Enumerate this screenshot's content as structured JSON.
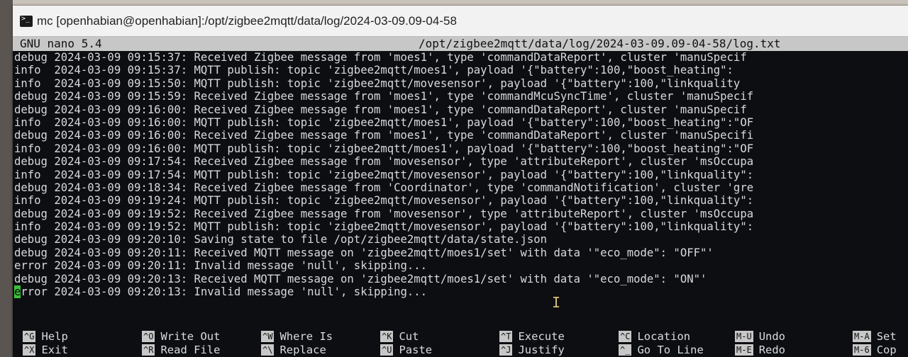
{
  "window": {
    "title": "mc [openhabian@openhabian]:/opt/zigbee2mqtt/data/log/2024-03-09.09-04-58"
  },
  "nano": {
    "version": "GNU nano 5.4",
    "filepath": "/opt/zigbee2mqtt/data/log/2024-03-09.09-04-58/log.txt"
  },
  "log_lines": [
    "debug 2024-03-09 09:15:37: Received Zigbee message from 'moes1', type 'commandDataReport', cluster 'manuSpecif",
    "info  2024-03-09 09:15:37: MQTT publish: topic 'zigbee2mqtt/moes1', payload '{\"battery\":100,\"boost_heating\":",
    "info  2024-03-09 09:15:50: MQTT publish: topic 'zigbee2mqtt/movesensor', payload '{\"battery\":100,\"linkquality",
    "debug 2024-03-09 09:15:59: Received Zigbee message from 'moes1', type 'commandMcuSyncTime', cluster 'manuSpecif",
    "debug 2024-03-09 09:16:00: Received Zigbee message from 'moes1', type 'commandDataReport', cluster 'manuSpecif",
    "info  2024-03-09 09:16:00: MQTT publish: topic 'zigbee2mqtt/moes1', payload '{\"battery\":100,\"boost_heating\":\"OF",
    "debug 2024-03-09 09:16:00: Received Zigbee message from 'moes1', type 'commandDataReport', cluster 'manuSpecifi",
    "info  2024-03-09 09:16:00: MQTT publish: topic 'zigbee2mqtt/moes1', payload '{\"battery\":100,\"boost_heating\":\"OF",
    "debug 2024-03-09 09:17:54: Received Zigbee message from 'movesensor', type 'attributeReport', cluster 'msOccupa",
    "info  2024-03-09 09:17:54: MQTT publish: topic 'zigbee2mqtt/movesensor', payload '{\"battery\":100,\"linkquality\":",
    "debug 2024-03-09 09:18:34: Received Zigbee message from 'Coordinator', type 'commandNotification', cluster 'gre",
    "info  2024-03-09 09:19:24: MQTT publish: topic 'zigbee2mqtt/movesensor', payload '{\"battery\":100,\"linkquality\":",
    "debug 2024-03-09 09:19:52: Received Zigbee message from 'movesensor', type 'attributeReport', cluster 'msOccupa",
    "info  2024-03-09 09:19:52: MQTT publish: topic 'zigbee2mqtt/movesensor', payload '{\"battery\":100,\"linkquality\":",
    "debug 2024-03-09 09:20:10: Saving state to file /opt/zigbee2mqtt/data/state.json",
    "debug 2024-03-09 09:20:11: Received MQTT message on 'zigbee2mqtt/moes1/set' with data '\"eco_mode\": \"OFF\"'",
    "error 2024-03-09 09:20:11: Invalid message 'null', skipping...",
    "debug 2024-03-09 09:20:13: Received MQTT message on 'zigbee2mqtt/moes1/set' with data '\"eco_mode\": \"ON\"'"
  ],
  "last_line": {
    "cursor_char": "e",
    "rest": "rror 2024-03-09 09:20:13: Invalid message 'null', skipping..."
  },
  "shortcuts": {
    "row1": [
      {
        "key": "^G",
        "label": "Help"
      },
      {
        "key": "^O",
        "label": "Write Out"
      },
      {
        "key": "^W",
        "label": "Where Is"
      },
      {
        "key": "^K",
        "label": "Cut"
      },
      {
        "key": "^T",
        "label": "Execute"
      },
      {
        "key": "^C",
        "label": "Location"
      },
      {
        "key": "M-U",
        "label": "Undo"
      },
      {
        "key": "M-A",
        "label": "Set"
      }
    ],
    "row2": [
      {
        "key": "^X",
        "label": "Exit"
      },
      {
        "key": "^R",
        "label": "Read File"
      },
      {
        "key": "^\\",
        "label": "Replace"
      },
      {
        "key": "^U",
        "label": "Paste"
      },
      {
        "key": "^J",
        "label": "Justify"
      },
      {
        "key": "^_",
        "label": "Go To Line"
      },
      {
        "key": "M-E",
        "label": "Redo"
      },
      {
        "key": "M-6",
        "label": "Cop"
      }
    ]
  }
}
